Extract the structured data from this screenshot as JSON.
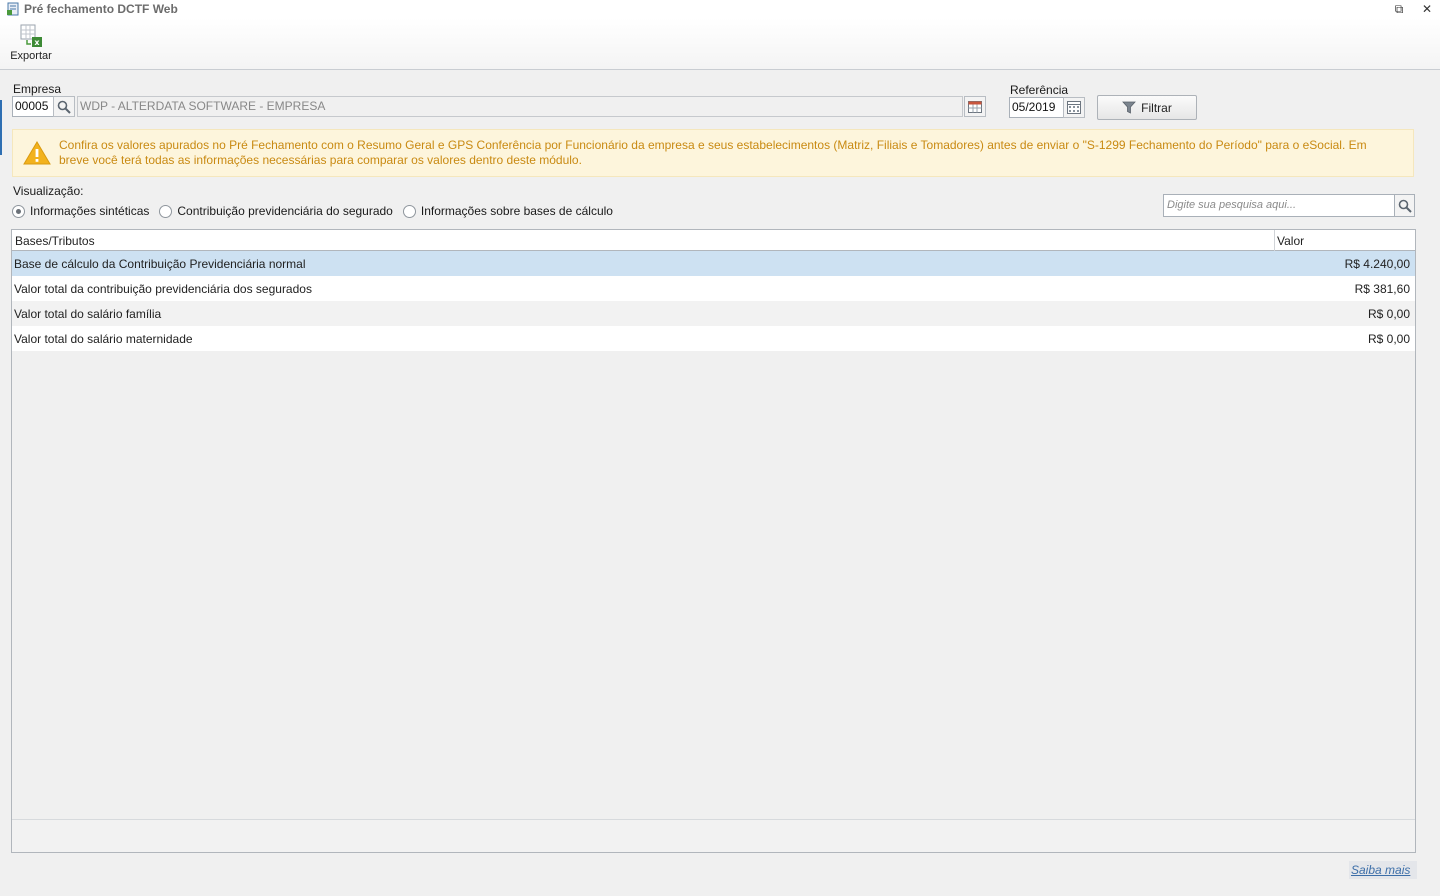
{
  "window": {
    "title": "Pré fechamento DCTF Web"
  },
  "toolbar": {
    "export_label": "Exportar"
  },
  "empresa": {
    "label": "Empresa",
    "code": "00005",
    "name": "WDP - ALTERDATA SOFTWARE - EMPRESA"
  },
  "referencia": {
    "label": "Referência",
    "value": "05/2019"
  },
  "filter_button": {
    "label": "Filtrar"
  },
  "warning": {
    "text": "Confira os valores apurados no Pré Fechamento com o Resumo Geral e GPS Conferência por Funcionário da empresa e seus estabelecimentos (Matriz, Filiais e Tomadores) antes de enviar o \"S-1299 Fechamento do Período\" para o eSocial. Em breve você terá todas as informações necessárias para comparar os valores dentro deste módulo.",
    "color": "#c98a12"
  },
  "visualizacao": {
    "label": "Visualização:",
    "options": [
      {
        "label": "Informações sintéticas",
        "checked": true
      },
      {
        "label": "Contribuição previdenciária do segurado",
        "checked": false
      },
      {
        "label": "Informações sobre bases de cálculo",
        "checked": false
      }
    ]
  },
  "search": {
    "placeholder": "Digite sua pesquisa aqui..."
  },
  "table": {
    "columns": [
      "Bases/Tributos",
      "Valor"
    ],
    "rows": [
      {
        "name": "Base de cálculo da Contribuição Previdenciária normal",
        "value": "R$ 4.240,00"
      },
      {
        "name": "Valor total da contribuição previdenciária dos segurados",
        "value": "R$ 381,60"
      },
      {
        "name": "Valor total do salário família",
        "value": "R$ 0,00"
      },
      {
        "name": "Valor total do salário maternidade",
        "value": "R$ 0,00"
      }
    ]
  },
  "footer": {
    "link": "Saiba mais"
  },
  "colors": {
    "selected_row": "#cde1f2",
    "warning_bg": "#fdf5dc",
    "link": "#3c6ea8"
  }
}
